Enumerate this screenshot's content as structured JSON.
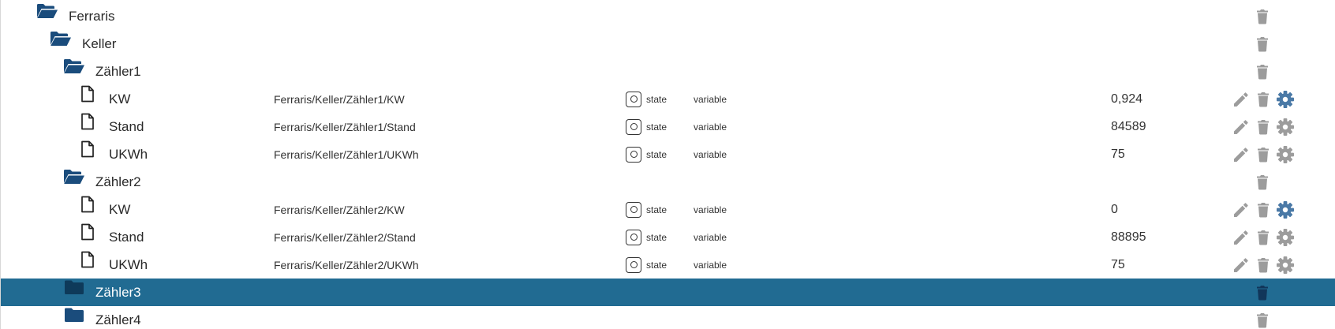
{
  "colors": {
    "folder": "#1a4c7c",
    "selected_row": "#216b92",
    "action_icon": "#9c9c9c",
    "gear_active": "#4a79a6"
  },
  "tree": {
    "rows": [
      {
        "type": "folder",
        "name": "Ferraris",
        "level": 0,
        "expanded": true,
        "selected": false
      },
      {
        "type": "folder",
        "name": "Keller",
        "level": 1,
        "expanded": true,
        "selected": false
      },
      {
        "type": "folder",
        "name": "Zähler1",
        "level": 2,
        "expanded": true,
        "selected": false
      },
      {
        "type": "state",
        "name": "KW",
        "level": 3,
        "path": "Ferraris/Keller/Zähler1/KW",
        "role": "state",
        "datatype": "variable",
        "value": "0,924",
        "gear_active": true
      },
      {
        "type": "state",
        "name": "Stand",
        "level": 3,
        "path": "Ferraris/Keller/Zähler1/Stand",
        "role": "state",
        "datatype": "variable",
        "value": "84589",
        "gear_active": false
      },
      {
        "type": "state",
        "name": "UKWh",
        "level": 3,
        "path": "Ferraris/Keller/Zähler1/UKWh",
        "role": "state",
        "datatype": "variable",
        "value": "75",
        "gear_active": false
      },
      {
        "type": "folder",
        "name": "Zähler2",
        "level": 2,
        "expanded": true,
        "selected": false
      },
      {
        "type": "state",
        "name": "KW",
        "level": 3,
        "path": "Ferraris/Keller/Zähler2/KW",
        "role": "state",
        "datatype": "variable",
        "value": "0",
        "gear_active": true
      },
      {
        "type": "state",
        "name": "Stand",
        "level": 3,
        "path": "Ferraris/Keller/Zähler2/Stand",
        "role": "state",
        "datatype": "variable",
        "value": "88895",
        "gear_active": false
      },
      {
        "type": "state",
        "name": "UKWh",
        "level": 3,
        "path": "Ferraris/Keller/Zähler2/UKWh",
        "role": "state",
        "datatype": "variable",
        "value": "75",
        "gear_active": false
      },
      {
        "type": "folder",
        "name": "Zähler3",
        "level": 2,
        "expanded": false,
        "selected": true
      },
      {
        "type": "folder",
        "name": "Zähler4",
        "level": 2,
        "expanded": false,
        "selected": false
      }
    ]
  }
}
